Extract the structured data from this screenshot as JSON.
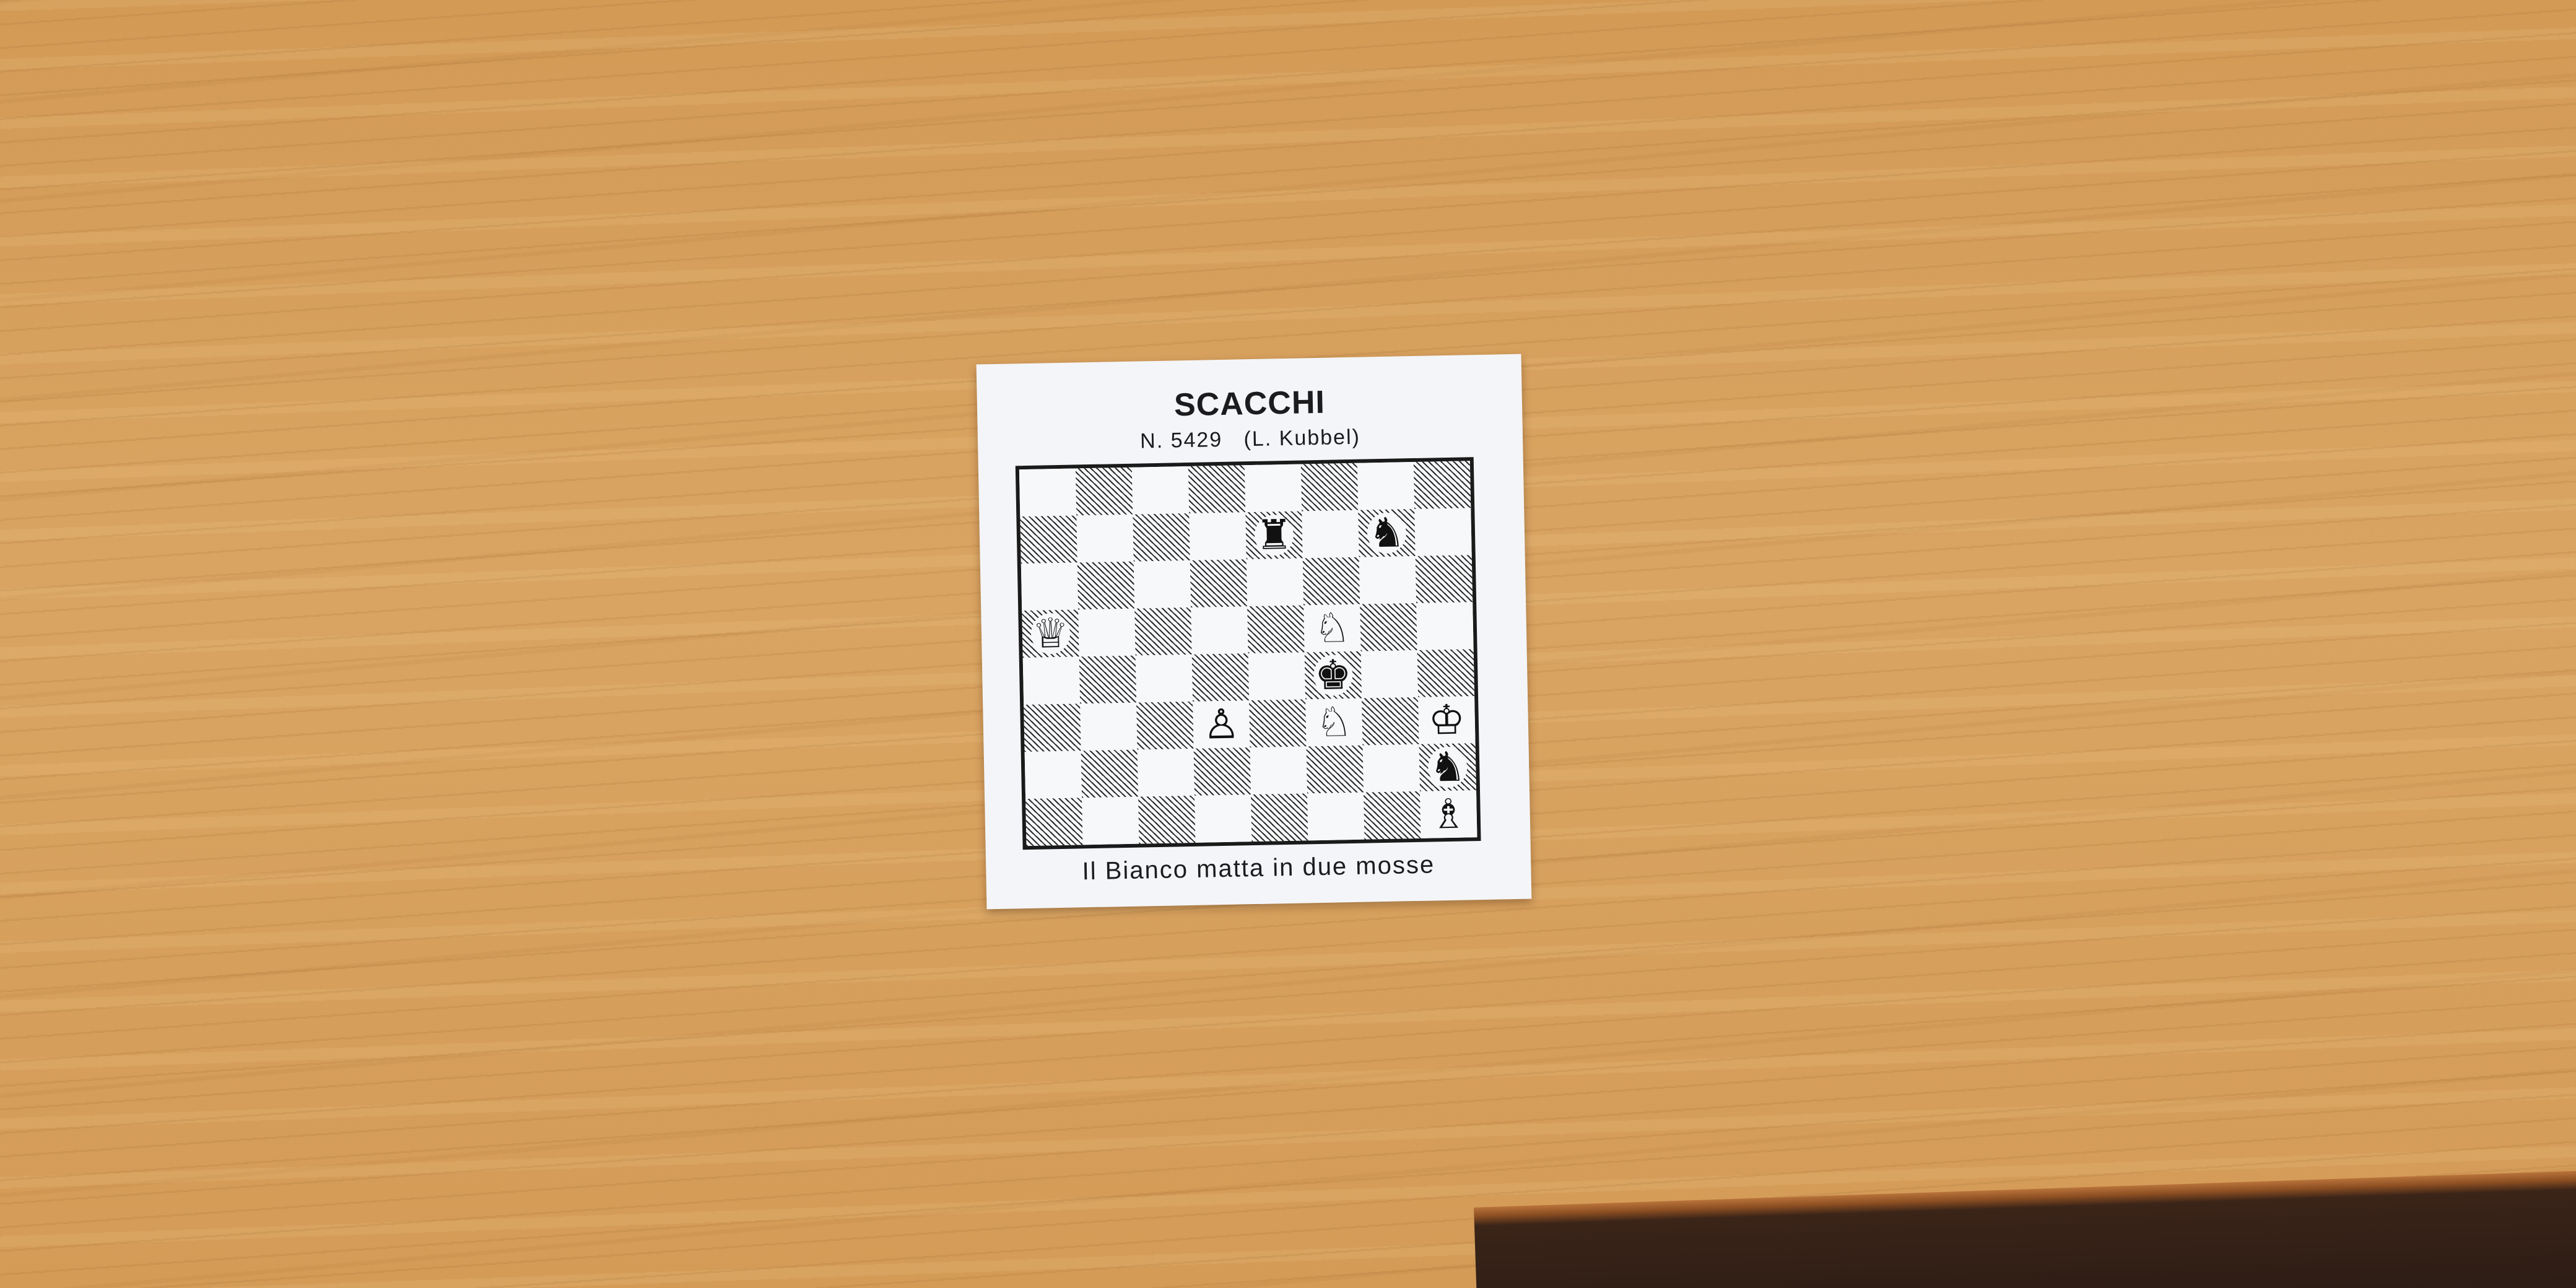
{
  "card": {
    "title": "SCACCHI",
    "subtitle": "N. 5429   (L. Kubbel)",
    "caption": "Il Bianco matta in due mosse"
  },
  "board": {
    "ranks": [
      [
        "",
        "",
        "",
        "",
        "",
        "",
        "",
        ""
      ],
      [
        "",
        "",
        "",
        "",
        "♜",
        "",
        "♞",
        ""
      ],
      [
        "",
        "",
        "",
        "",
        "",
        "",
        "",
        ""
      ],
      [
        "♕",
        "",
        "",
        "",
        "",
        "♘",
        "",
        ""
      ],
      [
        "",
        "",
        "",
        "",
        "",
        "♚",
        "",
        ""
      ],
      [
        "",
        "",
        "",
        "♙",
        "",
        "♘",
        "",
        "♔"
      ],
      [
        "",
        "",
        "",
        "",
        "",
        "",
        "",
        "♞"
      ],
      [
        "",
        "",
        "",
        "",
        "",
        "",
        "",
        "♗"
      ]
    ]
  }
}
